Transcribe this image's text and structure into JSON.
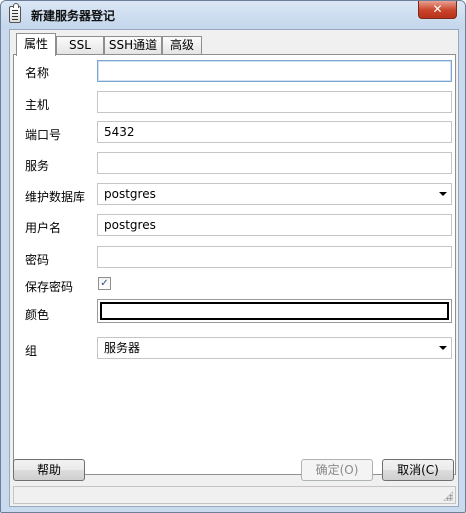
{
  "window": {
    "title": "新建服务器登记",
    "close_symbol": "✕"
  },
  "tabs": [
    {
      "label": "属性",
      "active": true
    },
    {
      "label": "SSL",
      "active": false
    },
    {
      "label": "SSH通道",
      "active": false
    },
    {
      "label": "高级",
      "active": false
    }
  ],
  "form": {
    "name": {
      "label": "名称",
      "value": ""
    },
    "host": {
      "label": "主机",
      "value": ""
    },
    "port": {
      "label": "端口号",
      "value": "5432"
    },
    "service": {
      "label": "服务",
      "value": ""
    },
    "maintenance_db": {
      "label": "维护数据库",
      "value": "postgres"
    },
    "username": {
      "label": "用户名",
      "value": "postgres"
    },
    "password": {
      "label": "密码",
      "value": ""
    },
    "store_password": {
      "label": "保存密码",
      "checked": true,
      "check_glyph": "✓"
    },
    "colour": {
      "label": "颜色",
      "value": "#ffffff"
    },
    "group": {
      "label": "组",
      "value": "服务器"
    }
  },
  "buttons": {
    "help": "帮助",
    "ok": "确定(O)",
    "cancel": "取消(C)"
  }
}
